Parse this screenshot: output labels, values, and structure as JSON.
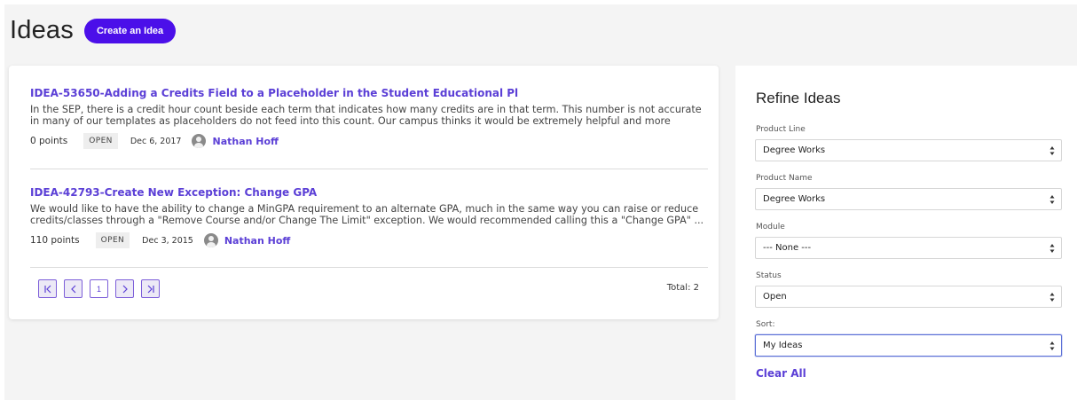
{
  "header": {
    "title": "Ideas",
    "create_label": "Create an Idea"
  },
  "ideas": [
    {
      "title": "IDEA-53650-Adding a Credits Field to a Placeholder in the Student Educational Pl",
      "description": "In the SEP, there is a credit hour count beside each term that indicates how many credits are in that term. This number is not accurate in many of our templates as placeholders do not feed into this count. Our campus thinks it would be extremely helpful and more accurate if ...",
      "points": "0 points",
      "status": "OPEN",
      "date": "Dec 6, 2017",
      "author": "Nathan Hoff"
    },
    {
      "title": "IDEA-42793-Create New Exception: Change GPA",
      "description": "We would like to have the ability to change a MinGPA requirement to an alternate GPA, much in the same way you can raise or reduce credits/classes through a \"Remove Course and/or Change The Limit\" exception. We would recommended calling this a \"Change GPA\" ...",
      "points": "110 points",
      "status": "OPEN",
      "date": "Dec 3, 2015",
      "author": "Nathan Hoff"
    }
  ],
  "pagination": {
    "current_page": "1",
    "total_text": "Total:  2"
  },
  "refine": {
    "title": "Refine Ideas",
    "fields": [
      {
        "label": "Product Line",
        "value": "Degree Works"
      },
      {
        "label": "Product Name",
        "value": "Degree Works"
      },
      {
        "label": "Module",
        "value": "--- None ---"
      },
      {
        "label": "Status",
        "value": "Open"
      },
      {
        "label": "Sort:",
        "value": "My Ideas"
      }
    ],
    "clear_all": "Clear All"
  },
  "colors": {
    "accent": "#4b0fe9",
    "link": "#5b3fd6",
    "page_background": "#f4f4f4"
  }
}
